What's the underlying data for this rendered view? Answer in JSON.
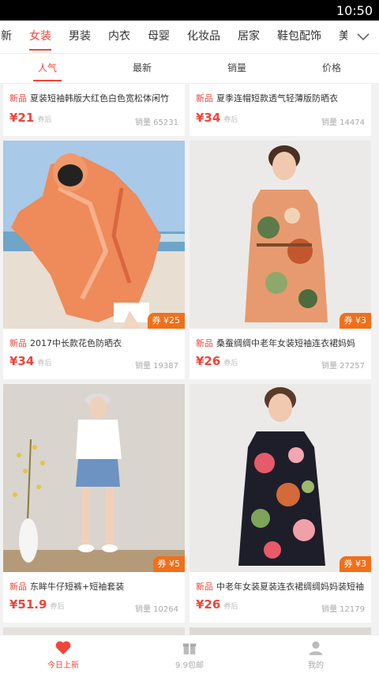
{
  "status_bar": {
    "time": "10:50"
  },
  "categories": {
    "items": [
      "新",
      "女装",
      "男装",
      "内衣",
      "母婴",
      "化妆品",
      "居家",
      "鞋包配饰",
      "美食"
    ],
    "active_index": 1,
    "more_icon": "chevron-down-icon"
  },
  "sort": {
    "items": [
      "人气",
      "最新",
      "销量",
      "价格"
    ],
    "active_index": 0
  },
  "products": [
    {
      "tag": "新品",
      "title": "夏装短袖韩版大红色白色宽松体闲竹",
      "price": "¥21",
      "price_note": "券后",
      "sales": "销量 65231",
      "coupon": ""
    },
    {
      "tag": "新品",
      "title": "夏季连帽短款透气轻薄版防晒衣",
      "price": "¥34",
      "price_note": "券后",
      "sales": "销量 14474",
      "coupon": ""
    },
    {
      "tag": "新品",
      "title": "2017中长款花色防晒衣",
      "price": "¥34",
      "price_note": "券后",
      "sales": "销量 19387",
      "coupon": "券 ¥25"
    },
    {
      "tag": "新品",
      "title": "桑蚕绸绸中老年女装短袖连衣裙妈妈",
      "price": "¥26",
      "price_note": "券后",
      "sales": "销量 27257",
      "coupon": "券 ¥3"
    },
    {
      "tag": "新品",
      "title": "东眸牛仔短裤+短袖套装",
      "price": "¥51.9",
      "price_note": "券后",
      "sales": "销量 10264",
      "coupon": "券 ¥5"
    },
    {
      "tag": "新品",
      "title": "中老年女装夏装连衣裙绸绸妈妈装短袖",
      "price": "¥26",
      "price_note": "券后",
      "sales": "销量 12179",
      "coupon": "券 ¥3"
    }
  ],
  "tabbar": {
    "items": [
      {
        "label": "今日上新",
        "icon": "heart-icon"
      },
      {
        "label": "9.9包邮",
        "icon": "gift-icon"
      },
      {
        "label": "我的",
        "icon": "user-icon"
      }
    ],
    "active_index": 0
  },
  "colors": {
    "accent": "#f0453a",
    "coupon": "#f26f1a"
  }
}
